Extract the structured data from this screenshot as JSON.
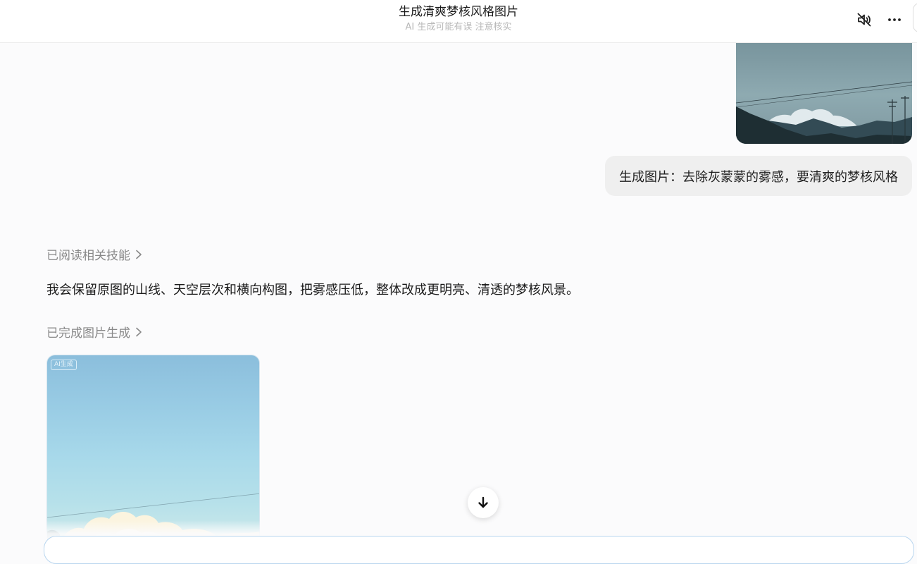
{
  "header": {
    "title": "生成清爽梦核风格图片",
    "subtitle": "AI 生成可能有误 注意核实",
    "icons": {
      "mute": "speaker-muted-icon",
      "more": "more-horizontal-icon"
    }
  },
  "messages": {
    "user_prompt": "生成图片：去除灰蒙蒙的雾感，要清爽的梦核风格",
    "skill_read_label": "已阅读相关技能",
    "reply_text": "我会保留原图的山线、天空层次和横向构图，把雾感压低，整体改成更明亮、清透的梦核风景。",
    "skill_done_label": "已完成图片生成",
    "ai_badge": "AI生成"
  },
  "icons": {
    "chevron": "chevron-right-icon",
    "scroll_down": "arrow-down-icon"
  },
  "colors": {
    "accent_border": "#b9d6ef",
    "bubble_bg": "#efefef",
    "muted_text": "#888888"
  }
}
